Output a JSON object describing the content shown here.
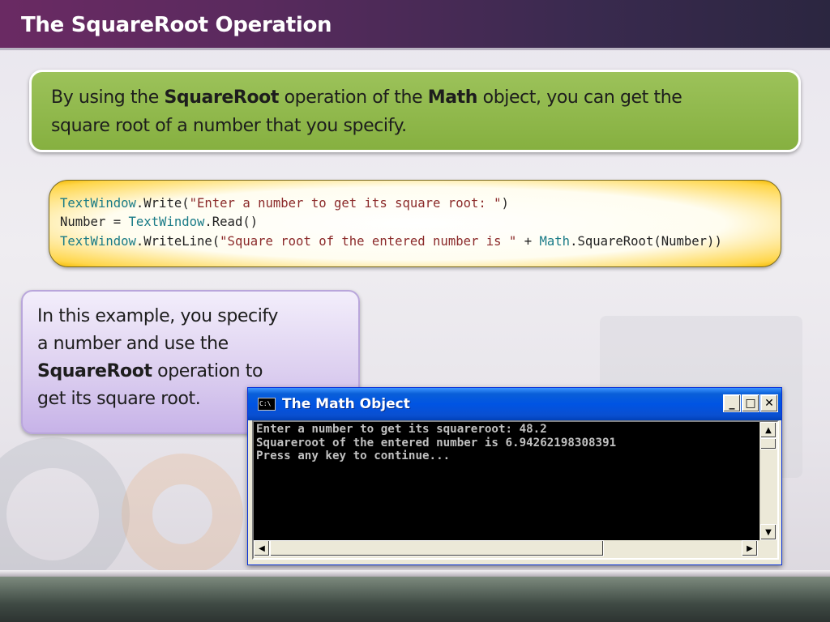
{
  "slide": {
    "title": "The SquareRoot Operation"
  },
  "intro": {
    "part1": "By using the ",
    "bold1": "SquareRoot",
    "part2": " operation of the ",
    "bold2": "Math",
    "part3": " object, you can get the",
    "line2": "square root of a number that you specify."
  },
  "code": {
    "line1": [
      {
        "text": "TextWindow",
        "kind": "obj"
      },
      {
        "text": ".Write(",
        "kind": "plain"
      },
      {
        "text": "\"Enter a number to get its square root: \"",
        "kind": "str"
      },
      {
        "text": ")",
        "kind": "plain"
      }
    ],
    "line2": [
      {
        "text": "Number = ",
        "kind": "plain"
      },
      {
        "text": "TextWindow",
        "kind": "obj"
      },
      {
        "text": ".Read()",
        "kind": "plain"
      }
    ],
    "line3": [
      {
        "text": "TextWindow",
        "kind": "obj"
      },
      {
        "text": ".WriteLine(",
        "kind": "plain"
      },
      {
        "text": "\"Square root of the entered number is \"",
        "kind": "str"
      },
      {
        "text": " + ",
        "kind": "plain"
      },
      {
        "text": "Math",
        "kind": "obj"
      },
      {
        "text": ".SquareRoot(Number))",
        "kind": "plain"
      }
    ]
  },
  "example": {
    "line1": "In this example, you specify",
    "line2": "a number and use the",
    "bold": "SquareRoot",
    "line3_rest": " operation to",
    "line4": "get its square root."
  },
  "console": {
    "icon_text": "C:\\",
    "title": "The Math Object",
    "minimize": "_",
    "maximize": "□",
    "close": "✕",
    "output": [
      "Enter a number to get its squareroot: 48.2",
      "Squareroot of the entered number is 6.94262198308391",
      "Press any key to continue..."
    ],
    "scroll_up": "▲",
    "scroll_down": "▼",
    "scroll_left": "◀",
    "scroll_right": "▶"
  },
  "colors": {
    "title_bar": "#5a2a5e",
    "green_box": "#8db84a",
    "code_box_edge": "#f2b800",
    "purple_box": "#d6c6ee",
    "console_title": "#0054e3",
    "code_object": "#1a7b87",
    "code_string": "#8b2a2a"
  }
}
